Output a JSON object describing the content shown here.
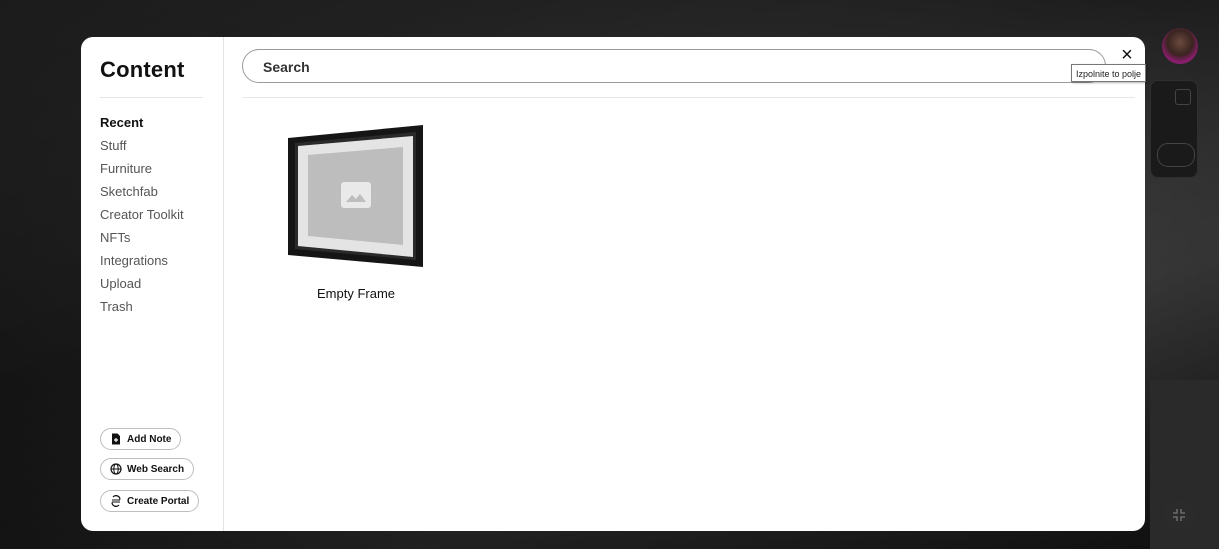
{
  "sidebar": {
    "title": "Content",
    "items": [
      {
        "label": "Recent",
        "active": true
      },
      {
        "label": "Stuff"
      },
      {
        "label": "Furniture"
      },
      {
        "label": "Sketchfab"
      },
      {
        "label": "Creator Toolkit"
      },
      {
        "label": "NFTs"
      },
      {
        "label": "Integrations"
      },
      {
        "label": "Upload"
      },
      {
        "label": "Trash"
      }
    ],
    "buttons": {
      "add_note": {
        "label": "Add Note",
        "icon": "note-add-icon"
      },
      "web_search": {
        "label": "Web Search",
        "icon": "globe-icon"
      },
      "create_portal": {
        "label": "Create Portal",
        "icon": "portal-icon"
      }
    }
  },
  "search": {
    "placeholder": "Search",
    "value": ""
  },
  "close": {
    "label": "×",
    "icon": "close-icon"
  },
  "tooltip": {
    "text": "Izpolnite to polje"
  },
  "items": [
    {
      "label": "Empty Frame",
      "icon": "image-placeholder-icon"
    }
  ],
  "colors": {
    "accent_avatar": "#9c2a7a",
    "modal_bg": "#ffffff"
  }
}
